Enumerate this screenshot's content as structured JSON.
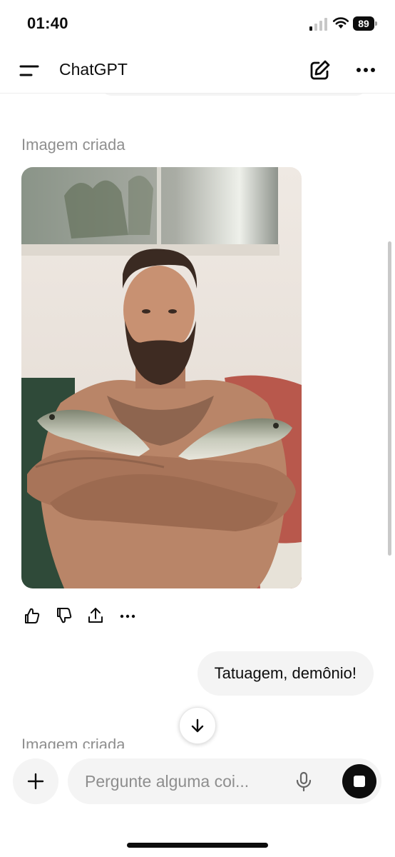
{
  "status_bar": {
    "time": "01:40",
    "battery": "89",
    "signal_bars_active": 1,
    "signal_bars_total": 4
  },
  "header": {
    "title": "ChatGPT"
  },
  "chat": {
    "messages": [
      {
        "role": "assistant",
        "type": "image",
        "label": "Imagem criada"
      },
      {
        "role": "user",
        "text": "Tatuagem, demônio!"
      },
      {
        "role": "assistant",
        "type": "image",
        "label": "Imagem criada"
      }
    ],
    "image_actions": [
      "thumbs-up-icon",
      "thumbs-down-icon",
      "share-icon",
      "more-icon"
    ]
  },
  "composer": {
    "placeholder": "Pergunte alguma coi..."
  },
  "colors": {
    "bubble": "#f4f4f4",
    "label": "#8f8f8f",
    "text": "#0d0d0d"
  }
}
